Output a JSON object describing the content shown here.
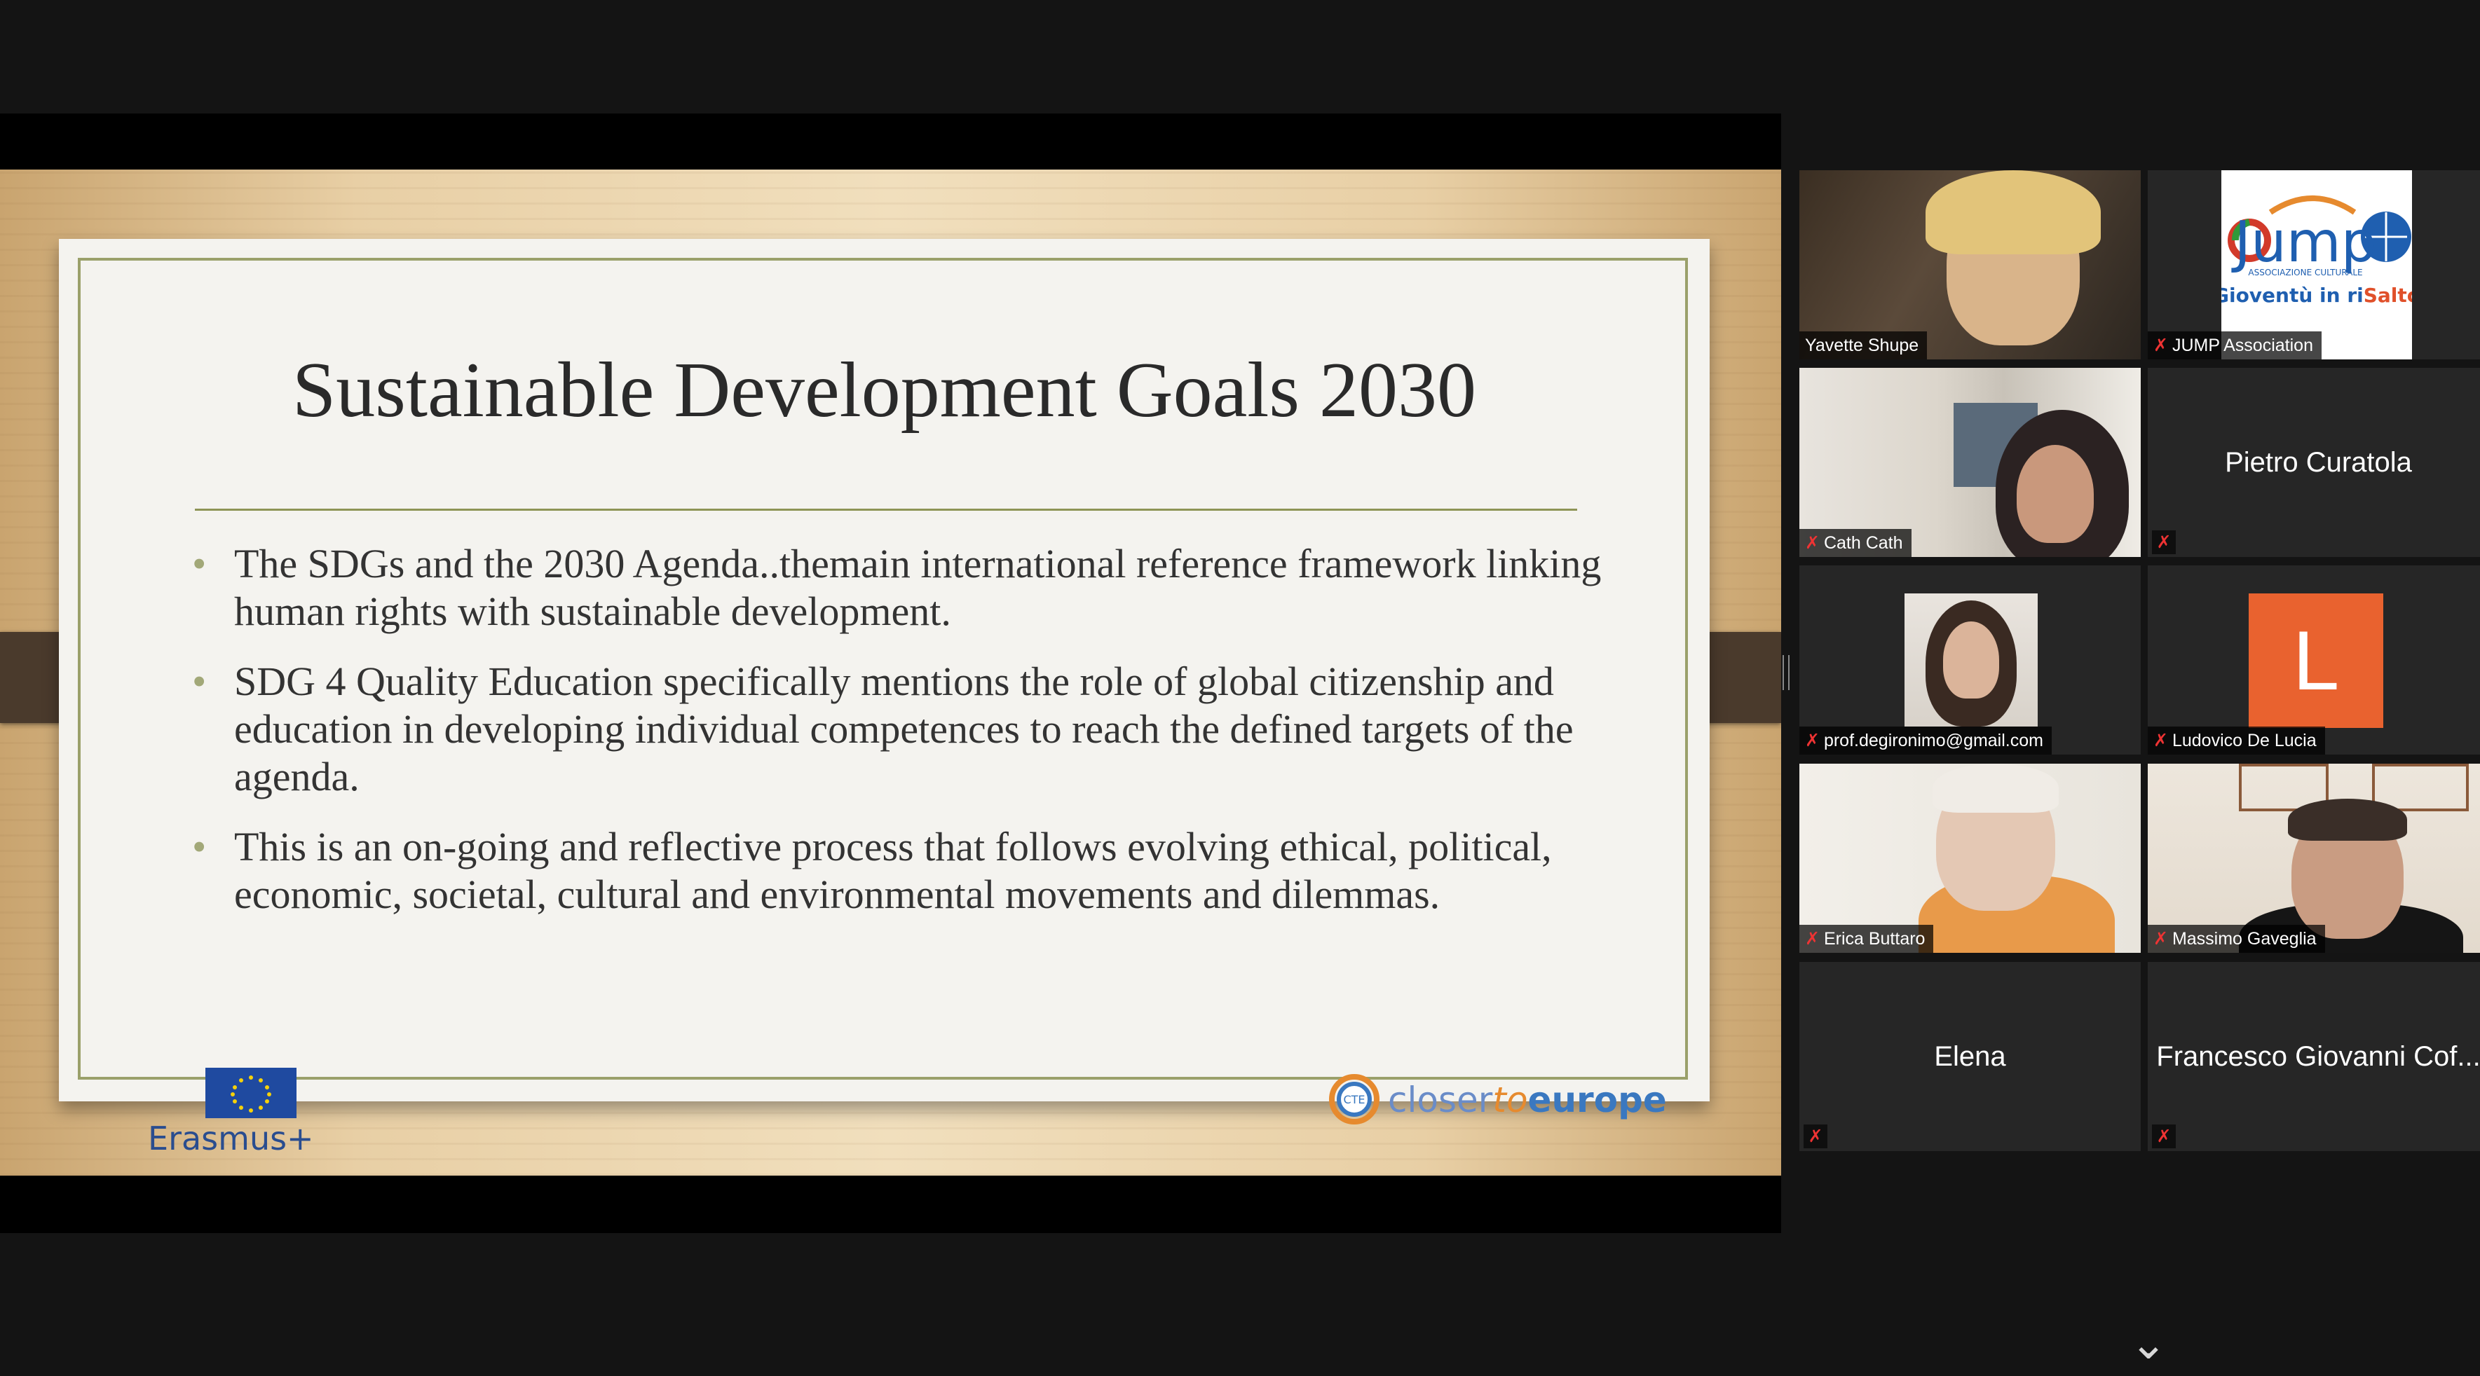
{
  "slide": {
    "title": "Sustainable Development Goals 2030",
    "bullets": [
      "The SDGs and the 2030 Agenda..themain international reference framework linking human rights with sustainable development.",
      "SDG 4  Quality Education specifically mentions the role of global citizenship and education in developing individual competences to reach the defined targets of  the agenda.",
      "This is an on-going and reflective process that follows evolving ethical, political, economic, societal, cultural and environmental movements and dilemmas."
    ],
    "erasmus_label": "Erasmus+",
    "cte_label_1": "closer",
    "cte_label_2": "to",
    "cte_label_3": "europe",
    "cte_badge": "CTE"
  },
  "participants": [
    {
      "name": "Yavette Shupe",
      "muted": false
    },
    {
      "name": "JUMP Association",
      "muted": true
    },
    {
      "name": "Cath Cath",
      "muted": true
    },
    {
      "name": "Pietro Curatola",
      "muted": true
    },
    {
      "name": "prof.degironimo@gmail.com",
      "muted": true
    },
    {
      "name": "Ludovico De Lucia",
      "muted": true
    },
    {
      "name": "Erica Buttaro",
      "muted": true
    },
    {
      "name": "Massimo Gaveglia",
      "muted": true
    },
    {
      "name": "Elena",
      "muted": true
    },
    {
      "name": "Francesco Giovanni Cof...",
      "muted": true
    }
  ],
  "jump_logo": {
    "brand": "Jump",
    "sub": "ASSOCIAZIONE CULTURALE",
    "tagline_1": "Gioventù in ri",
    "tagline_2": "Salto"
  },
  "avatar_letter": "L",
  "icons": {
    "mic_off": "✗",
    "chevron_up": "⌃",
    "chevron_down": "⌄"
  },
  "colors": {
    "active_speaker_border": "#d8de6b",
    "muted_icon": "#e33333",
    "avatar_L": "#e9622f"
  }
}
